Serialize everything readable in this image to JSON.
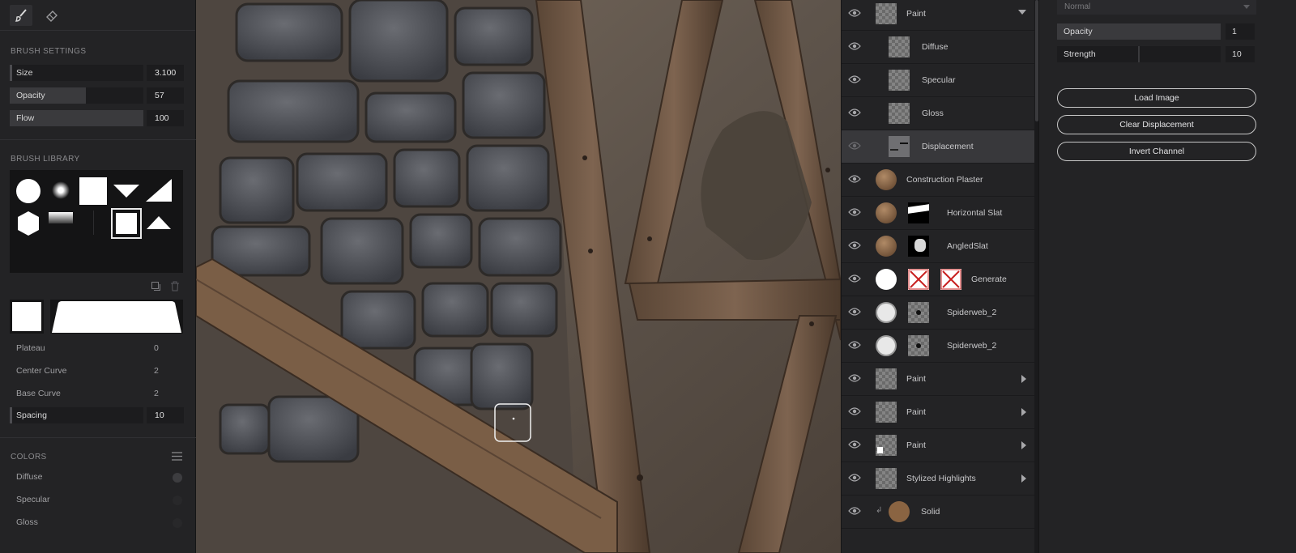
{
  "brush_settings": {
    "title": "BRUSH SETTINGS",
    "size": {
      "label": "Size",
      "value": "3.100"
    },
    "opacity": {
      "label": "Opacity",
      "value": "57"
    },
    "flow": {
      "label": "Flow",
      "value": "100"
    }
  },
  "brush_library": {
    "title": "BRUSH LIBRARY"
  },
  "falloff": {
    "plateau": {
      "label": "Plateau",
      "value": "0"
    },
    "center_curve": {
      "label": "Center Curve",
      "value": "2"
    },
    "base_curve": {
      "label": "Base Curve",
      "value": "2"
    },
    "spacing": {
      "label": "Spacing",
      "value": "10"
    }
  },
  "colors": {
    "title": "COLORS",
    "items": [
      "Diffuse",
      "Specular",
      "Gloss"
    ]
  },
  "layers": [
    {
      "name": "Paint",
      "thumbs": [
        "checker"
      ],
      "arrow": "down",
      "selected": false
    },
    {
      "name": "Diffuse",
      "thumbs": [
        "checker"
      ],
      "child": true,
      "selected": false
    },
    {
      "name": "Specular",
      "thumbs": [
        "checker"
      ],
      "child": true,
      "selected": false
    },
    {
      "name": "Gloss",
      "thumbs": [
        "checker"
      ],
      "child": true,
      "selected": false
    },
    {
      "name": "Displacement",
      "thumbs": [
        "displacement"
      ],
      "child": true,
      "selected": true
    },
    {
      "name": "Construction Plaster",
      "thumbs": [
        "material"
      ],
      "selected": false
    },
    {
      "name": "Horizontal Slat",
      "thumbs": [
        "material",
        "mask"
      ],
      "selected": false
    },
    {
      "name": "AngledSlat",
      "thumbs": [
        "material",
        "mask2"
      ],
      "selected": false
    },
    {
      "name": "Generate",
      "thumbs": [
        "white-circle",
        "missing",
        "missing"
      ],
      "selected": false
    },
    {
      "name": "Spiderweb_2",
      "thumbs": [
        "web",
        "dot"
      ],
      "selected": false
    },
    {
      "name": "Spiderweb_2",
      "thumbs": [
        "web",
        "dot"
      ],
      "selected": false
    },
    {
      "name": "Paint",
      "thumbs": [
        "checker"
      ],
      "arrow": "right",
      "selected": false
    },
    {
      "name": "Paint",
      "thumbs": [
        "checker"
      ],
      "arrow": "right",
      "selected": false
    },
    {
      "name": "Paint",
      "thumbs": [
        "checker-mark"
      ],
      "arrow": "right",
      "selected": false
    },
    {
      "name": "Stylized Highlights",
      "thumbs": [
        "checker"
      ],
      "arrow": "right",
      "selected": false
    },
    {
      "name": "Solid",
      "thumbs": [
        "solid"
      ],
      "selected": false
    }
  ],
  "properties": {
    "blend_mode": "Normal",
    "opacity": {
      "label": "Opacity",
      "value": "1"
    },
    "strength": {
      "label": "Strength",
      "value": "10"
    },
    "load_image": "Load Image",
    "clear_displacement": "Clear Displacement",
    "invert_channel": "Invert Channel"
  },
  "icons": {
    "paint_tool": "brush-icon",
    "erase_tool": "eraser-icon",
    "visibility": "eye-icon",
    "duplicate": "duplicate-icon",
    "delete": "trash-icon",
    "menu": "hamburger-icon"
  },
  "colors_theme": {
    "panel": "#232325",
    "field": "#1c1c1e",
    "selected_layer": "#38383b",
    "text": "#c8c8c8"
  }
}
